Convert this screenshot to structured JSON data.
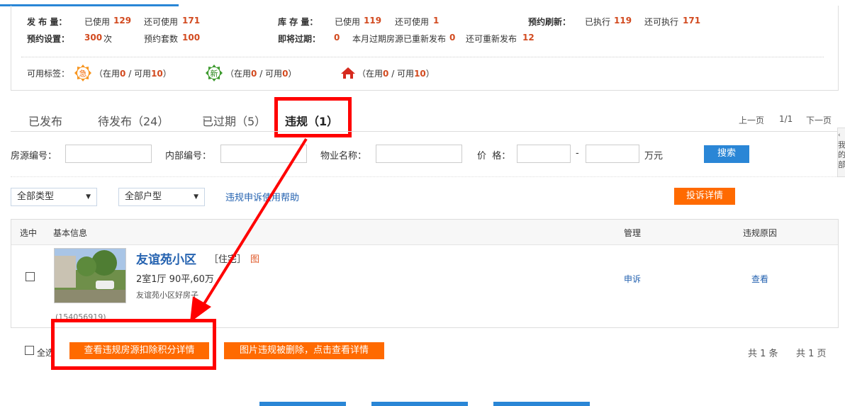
{
  "stats": {
    "row1": {
      "publish_label": "发 布 量：",
      "publish_used_label": "已使用",
      "publish_used": "129",
      "publish_avail_label": "还可使用",
      "publish_avail": "171",
      "stock_label": "库 存 量：",
      "stock_used_label": "已使用",
      "stock_used": "119",
      "stock_avail_label": "还可使用",
      "stock_avail": "1",
      "refresh_label": "预约刷新：",
      "refresh_done_label": "已执行",
      "refresh_done": "119",
      "refresh_avail_label": "还可执行",
      "refresh_avail": "171"
    },
    "row2": {
      "schedule_label": "预约设置：",
      "schedule_count": "300",
      "schedule_unit": "次",
      "sets_label": "预约套数",
      "sets_count": "100",
      "expiring_label": "即将过期：",
      "expiring_count": "0",
      "republish_label": "本月过期房源已重新发布",
      "republish_count": "0",
      "can_republish_label": "还可重新发布",
      "can_republish_count": "12"
    },
    "tags": {
      "label": "可用标签：",
      "urgent_icon_text": "急",
      "new_icon_text": "新",
      "t1_pre": "（在用",
      "t1_used": "0",
      "t1_mid": " / 可用",
      "t1_avail": "10",
      "t1_post": "）",
      "t2_pre": "（在用",
      "t2_used": "0",
      "t2_mid": " / 可用",
      "t2_avail": "0",
      "t2_post": "）",
      "t3_pre": "（在用",
      "t3_used": "0",
      "t3_mid": " / 可用",
      "t3_avail": "10",
      "t3_post": "）"
    }
  },
  "tabs": [
    {
      "label": "已发布"
    },
    {
      "label": "待发布（24）"
    },
    {
      "label": "已过期（5）"
    },
    {
      "label": "违规（1）"
    }
  ],
  "pager": {
    "prev": "上一页",
    "page": "1/1",
    "next": "下一页"
  },
  "side_tab": {
    "line1": "我",
    "line2": "的",
    "line3": "部"
  },
  "search": {
    "source_no_label": "房源编号：",
    "internal_no_label": "内部编号：",
    "property_label": "物业名称：",
    "price_label": "价  格：",
    "price_sep": "-",
    "price_unit": "万元",
    "search_button": "搜索"
  },
  "filters": {
    "type_select": "全部类型",
    "layout_select": "全部户型",
    "help_link": "违规申诉使用帮助",
    "complaint_button": "投诉详情"
  },
  "table": {
    "headers": {
      "select": "选中",
      "info": "基本信息",
      "manage": "管理",
      "reason": "违规原因"
    },
    "row": {
      "title": "友谊苑小区",
      "category": "［住宅］",
      "image_tag": "图",
      "summary": "2室1厅 90平,60万",
      "desc": "友谊苑小区好房子",
      "id": "(154056919)",
      "appeal": "申诉",
      "view": "查看"
    }
  },
  "footer": {
    "select_all": "全选",
    "deduct_button": "查看违规房源扣除积分详情",
    "image_deleted_button": "图片违规被删除，点击查看详情",
    "total_text": "共 1 条",
    "pages_text": "共 1 页"
  },
  "colors": {
    "accent_blue": "#2a86d6",
    "accent_orange": "#ff6a00",
    "highlight_red": "#ff0000",
    "value_red": "#d24a1f"
  }
}
